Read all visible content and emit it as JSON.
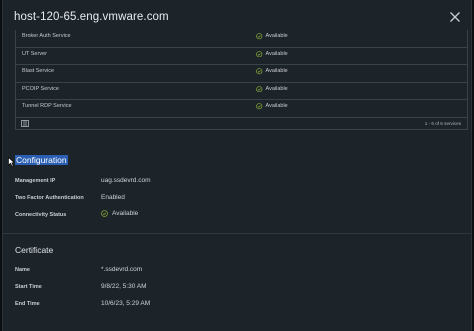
{
  "window": {
    "title": "host-120-65.eng.vmware.com"
  },
  "services": {
    "rows": [
      {
        "name": "Broker Auth Service",
        "status": "Available"
      },
      {
        "name": "UT Server",
        "status": "Available"
      },
      {
        "name": "Blast Service",
        "status": "Available"
      },
      {
        "name": "PCOIP Service",
        "status": "Available"
      },
      {
        "name": "Tunnel RDP Service",
        "status": "Available"
      }
    ],
    "pager": "1 - 6 of 6 services"
  },
  "configuration": {
    "title": "Configuration",
    "fields": [
      {
        "label": "Management IP",
        "value": "uag.ssdevrd.com"
      },
      {
        "label": "Two Factor Authentication",
        "value": "Enabled"
      },
      {
        "label": "Connectivity Status",
        "value": "Available"
      }
    ]
  },
  "certificate": {
    "title": "Certificate",
    "fields": [
      {
        "label": "Name",
        "value": "*.ssdevrd.com"
      },
      {
        "label": "Start Time",
        "value": "9/8/22, 5:30 AM"
      },
      {
        "label": "End Time",
        "value": "10/6/23, 5:29 AM"
      }
    ]
  },
  "colors": {
    "panel": "#1c2329",
    "accent_selection": "#2a5fb3",
    "status_ok": "#8fb33b"
  },
  "icons": {
    "close": "close-icon",
    "status": "check-circle-icon",
    "columns": "column-toggle-icon"
  }
}
